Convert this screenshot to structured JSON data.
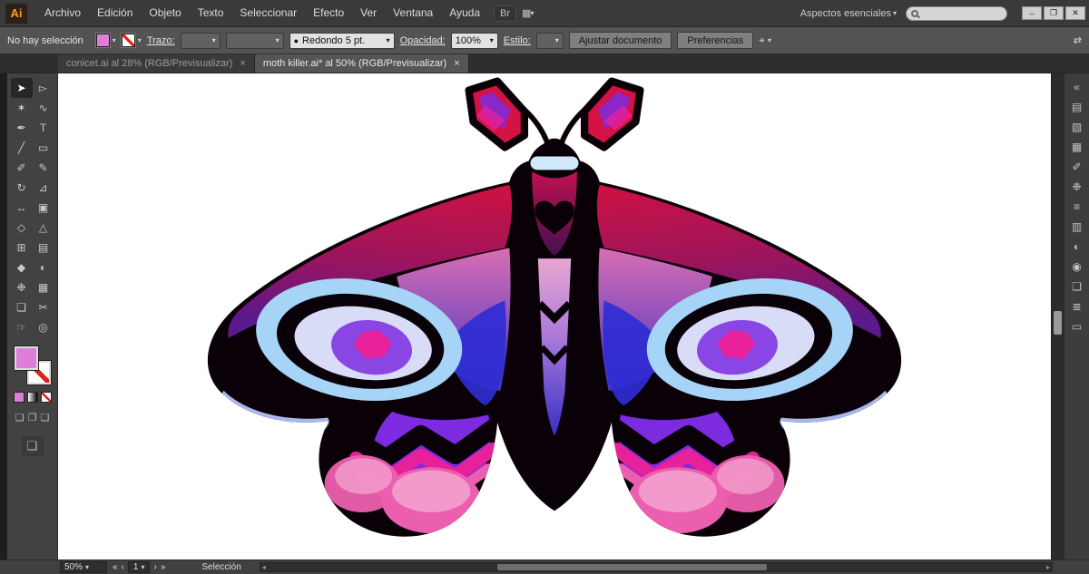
{
  "colors": {
    "ai_orange": "#ff9a1e",
    "fill_swatch": "#de7ed8",
    "stroke_none_red": "#e2211c",
    "moth_black": "#0a0108",
    "moth_red": "#d41244",
    "moth_magenta": "#e6219a",
    "moth_pink": "#ec5fae",
    "moth_pink_light": "#f5a8d2",
    "moth_purple": "#7c2be0",
    "moth_blue_deep": "#2f2cd2",
    "moth_blue_pale": "#a6d4f6",
    "moth_blue_ice": "#cfe8fb",
    "moth_lavender": "#d8dcf6",
    "moth_periwinkle": "#a9b7ec",
    "moth_inner_pink": "#ee7ac6",
    "moth_inner_blue": "#4a3ad8",
    "moth_thorax_top": "#c01050",
    "moth_thorax_bottom": "#46104e",
    "moth_abdomen_top": "#f4b0dc",
    "moth_abdomen_mid": "#b17fe4",
    "moth_abdomen_bottom": "#3b31cf"
  },
  "icons": {
    "chevron_down": "▾",
    "double_arrow": "⇄",
    "collapse_dock": "«",
    "layout_grid": "▦",
    "brush_dot": "●",
    "tool_options": "⌖",
    "hscroll_left": "◂",
    "hscroll_right": "▸"
  },
  "window": {
    "minimize": "–",
    "restore": "❐",
    "close": "✕"
  },
  "menubar": {
    "logo": "Ai",
    "items": [
      "Archivo",
      "Edición",
      "Objeto",
      "Texto",
      "Seleccionar",
      "Efecto",
      "Ver",
      "Ventana",
      "Ayuda"
    ],
    "bridge_label": "Br",
    "workspace_label": "Aspectos esenciales"
  },
  "controlbar": {
    "selection_status": "No hay selección",
    "stroke_label": "Trazo:",
    "brush_value": "Redondo 5 pt.",
    "opacity_label": "Opacidad:",
    "opacity_value": "100%",
    "style_label": "Estilo:",
    "fit_button": "Ajustar documento",
    "prefs_button": "Preferencias"
  },
  "tabbar": {
    "close_glyph": "×",
    "tabs": [
      {
        "label": "conicet.ai al 28% (RGB/Previsualizar)",
        "active": false
      },
      {
        "label": "moth killer.ai* al 50% (RGB/Previsualizar)",
        "active": true
      }
    ]
  },
  "toolbar": {
    "tools": [
      {
        "name": "selection-tool-icon",
        "glyph": "➤",
        "active": true
      },
      {
        "name": "direct-selection-tool-icon",
        "glyph": "▻",
        "active": false
      },
      {
        "name": "magic-wand-tool-icon",
        "glyph": "✶",
        "active": false
      },
      {
        "name": "lasso-tool-icon",
        "glyph": "∿",
        "active": false
      },
      {
        "name": "pen-tool-icon",
        "glyph": "✒",
        "active": false
      },
      {
        "name": "type-tool-icon",
        "glyph": "T",
        "active": false
      },
      {
        "name": "line-segment-tool-icon",
        "glyph": "╱",
        "active": false
      },
      {
        "name": "rectangle-tool-icon",
        "glyph": "▭",
        "active": false
      },
      {
        "name": "paintbrush-tool-icon",
        "glyph": "✐",
        "active": false
      },
      {
        "name": "pencil-tool-icon",
        "glyph": "✎",
        "active": false
      },
      {
        "name": "rotate-tool-icon",
        "glyph": "↻",
        "active": false
      },
      {
        "name": "scale-tool-icon",
        "glyph": "⊿",
        "active": false
      },
      {
        "name": "width-tool-icon",
        "glyph": "↔",
        "active": false
      },
      {
        "name": "free-transform-tool-icon",
        "glyph": "▣",
        "active": false
      },
      {
        "name": "shape-builder-tool-icon",
        "glyph": "◇",
        "active": false
      },
      {
        "name": "perspective-grid-tool-icon",
        "glyph": "△",
        "active": false
      },
      {
        "name": "mesh-tool-icon",
        "glyph": "⊞",
        "active": false
      },
      {
        "name": "gradient-tool-icon",
        "glyph": "▤",
        "active": false
      },
      {
        "name": "eyedropper-tool-icon",
        "glyph": "◆",
        "active": false
      },
      {
        "name": "blend-tool-icon",
        "glyph": "◐",
        "active": false
      },
      {
        "name": "symbol-sprayer-tool-icon",
        "glyph": "❉",
        "active": false
      },
      {
        "name": "column-graph-tool-icon",
        "glyph": "▦",
        "active": false
      },
      {
        "name": "artboard-tool-icon",
        "glyph": "❏",
        "active": false
      },
      {
        "name": "slice-tool-icon",
        "glyph": "✂",
        "active": false
      },
      {
        "name": "hand-tool-icon",
        "glyph": "☞",
        "active": false
      },
      {
        "name": "zoom-tool-icon",
        "glyph": "◎",
        "active": false
      }
    ],
    "mode_glyphs": [
      "❏",
      "❐",
      "❑"
    ],
    "solo_glyph": "❑"
  },
  "right_dock": {
    "icons": [
      {
        "name": "collapse-panels-icon",
        "glyph": "«"
      },
      {
        "name": "color-panel-icon",
        "glyph": "▤"
      },
      {
        "name": "color-guide-panel-icon",
        "glyph": "▧"
      },
      {
        "name": "swatches-panel-icon",
        "glyph": "▦"
      },
      {
        "name": "brushes-panel-icon",
        "glyph": "✐"
      },
      {
        "name": "symbols-panel-icon",
        "glyph": "❉"
      },
      {
        "name": "stroke-panel-icon",
        "glyph": "≡"
      },
      {
        "name": "gradient-panel-icon",
        "glyph": "▥"
      },
      {
        "name": "transparency-panel-icon",
        "glyph": "◐"
      },
      {
        "name": "appearance-panel-icon",
        "glyph": "◉"
      },
      {
        "name": "graphic-styles-panel-icon",
        "glyph": "❏"
      },
      {
        "name": "layers-panel-icon",
        "glyph": "≣"
      },
      {
        "name": "artboards-panel-icon",
        "glyph": "▭"
      }
    ]
  },
  "statusbar": {
    "zoom_value": "50%",
    "first": "«",
    "prev": "‹",
    "next": "›",
    "last": "»",
    "artboard_value": "1",
    "tool_label": "Selección"
  }
}
